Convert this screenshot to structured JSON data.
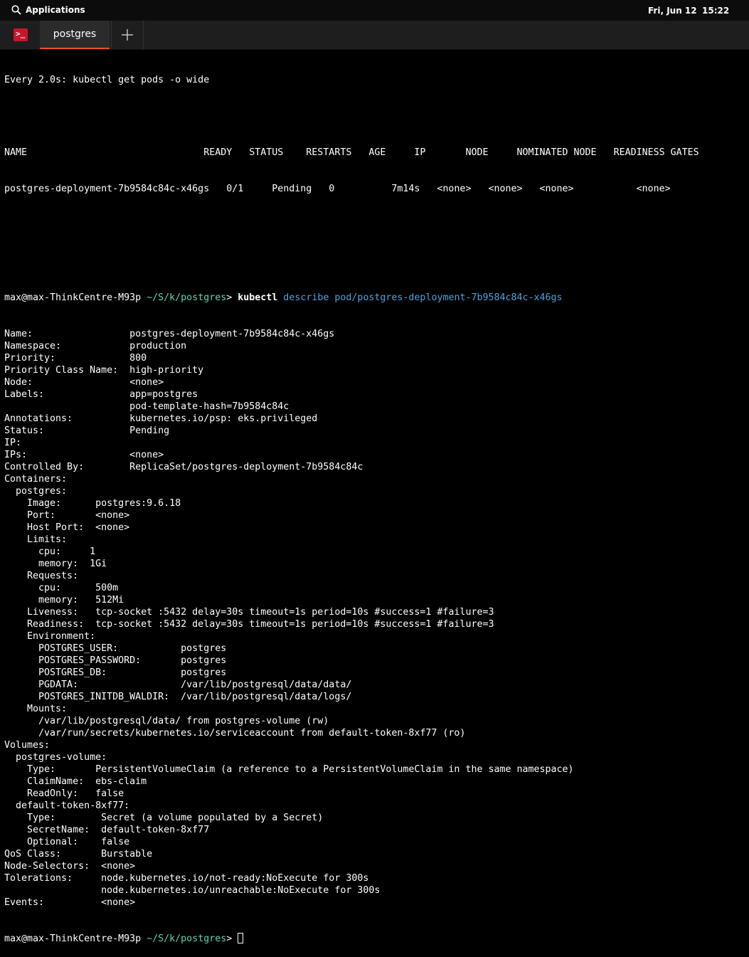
{
  "topbar": {
    "applications_label": "Applications",
    "date": "Fri, Jun 12",
    "time": "15:22"
  },
  "tabs": {
    "active_label": "postgres",
    "new_tab_icon": "plus-icon",
    "terminal_icon": "terminal-icon"
  },
  "colors": {
    "accent": "#e95420",
    "path_color": "#5fd7af",
    "arg_color": "#4aa3e0"
  },
  "terminal": {
    "watch_header": "Every 2.0s: kubectl get pods -o wide",
    "pods_header": "NAME                               READY   STATUS    RESTARTS   AGE     IP       NODE     NOMINATED NODE   READINESS GATES",
    "pods_row": "postgres-deployment-7b9584c84c-x46gs   0/1     Pending   0          7m14s   <none>   <none>   <none>           <none>",
    "prompt_user": "max@max-ThinkCentre-M93p",
    "prompt_path": " ~/S/k/postgres",
    "prompt_symbol": "> ",
    "command": "kubectl",
    "command_args": " describe pod/postgres-deployment-7b9584c84c-x46gs",
    "output": [
      "Name:                 postgres-deployment-7b9584c84c-x46gs",
      "Namespace:            production",
      "Priority:             800",
      "Priority Class Name:  high-priority",
      "Node:                 <none>",
      "Labels:               app=postgres",
      "                      pod-template-hash=7b9584c84c",
      "Annotations:          kubernetes.io/psp: eks.privileged",
      "Status:               Pending",
      "IP:",
      "IPs:                  <none>",
      "Controlled By:        ReplicaSet/postgres-deployment-7b9584c84c",
      "Containers:",
      "  postgres:",
      "    Image:      postgres:9.6.18",
      "    Port:       <none>",
      "    Host Port:  <none>",
      "    Limits:",
      "      cpu:     1",
      "      memory:  1Gi",
      "    Requests:",
      "      cpu:      500m",
      "      memory:   512Mi",
      "    Liveness:   tcp-socket :5432 delay=30s timeout=1s period=10s #success=1 #failure=3",
      "    Readiness:  tcp-socket :5432 delay=30s timeout=1s period=10s #success=1 #failure=3",
      "    Environment:",
      "      POSTGRES_USER:           postgres",
      "      POSTGRES_PASSWORD:       postgres",
      "      POSTGRES_DB:             postgres",
      "      PGDATA:                  /var/lib/postgresql/data/data/",
      "      POSTGRES_INITDB_WALDIR:  /var/lib/postgresql/data/logs/",
      "    Mounts:",
      "      /var/lib/postgresql/data/ from postgres-volume (rw)",
      "      /var/run/secrets/kubernetes.io/serviceaccount from default-token-8xf77 (ro)",
      "Volumes:",
      "  postgres-volume:",
      "    Type:       PersistentVolumeClaim (a reference to a PersistentVolumeClaim in the same namespace)",
      "    ClaimName:  ebs-claim",
      "    ReadOnly:   false",
      "  default-token-8xf77:",
      "    Type:        Secret (a volume populated by a Secret)",
      "    SecretName:  default-token-8xf77",
      "    Optional:    false",
      "QoS Class:       Burstable",
      "Node-Selectors:  <none>",
      "Tolerations:     node.kubernetes.io/not-ready:NoExecute for 300s",
      "                 node.kubernetes.io/unreachable:NoExecute for 300s",
      "Events:          <none>"
    ]
  }
}
